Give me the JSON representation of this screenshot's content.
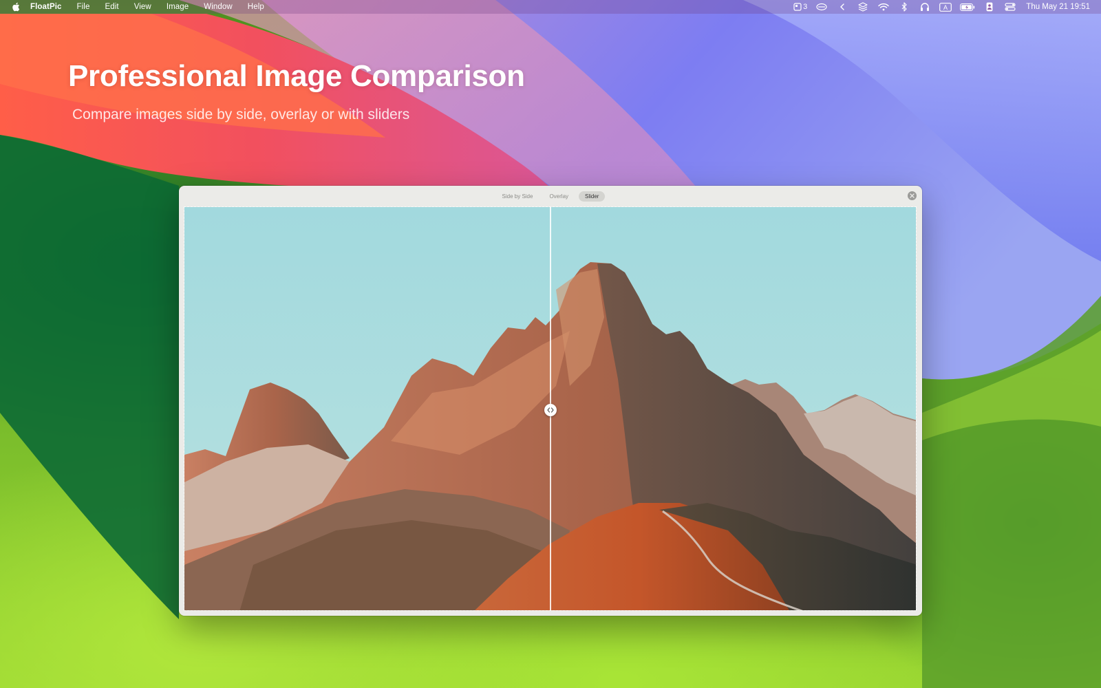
{
  "menubar": {
    "app_name": "FloatPic",
    "menus": [
      "File",
      "Edit",
      "View",
      "Image",
      "Window",
      "Help"
    ],
    "status_icons": [
      "screens-icon",
      "vpn-icon",
      "chevron-left-icon",
      "stack-icon",
      "wifi-icon",
      "bluetooth-icon",
      "headphones-icon",
      "input-source-icon",
      "battery-icon",
      "user-icon",
      "control-center-icon"
    ],
    "screens_count": "3",
    "input_source": "A",
    "clock": "Thu May 21  19:51"
  },
  "hero": {
    "title": "Professional Image Comparison",
    "subtitle": "Compare images side by side, overlay or with sliders"
  },
  "window": {
    "modes": [
      "Side by Side",
      "Overlay",
      "Slider"
    ],
    "active_mode": "Slider",
    "slider_position": 0.5
  },
  "colors": {
    "sky": "#a9dde0",
    "rock_warm": "#b5694a",
    "rock_dark": "#4a4540",
    "meadow": "#c4562a",
    "wallpaper_green": "#6fb32a",
    "wallpaper_red": "#f0535c",
    "wallpaper_blue": "#7b7cf0"
  }
}
